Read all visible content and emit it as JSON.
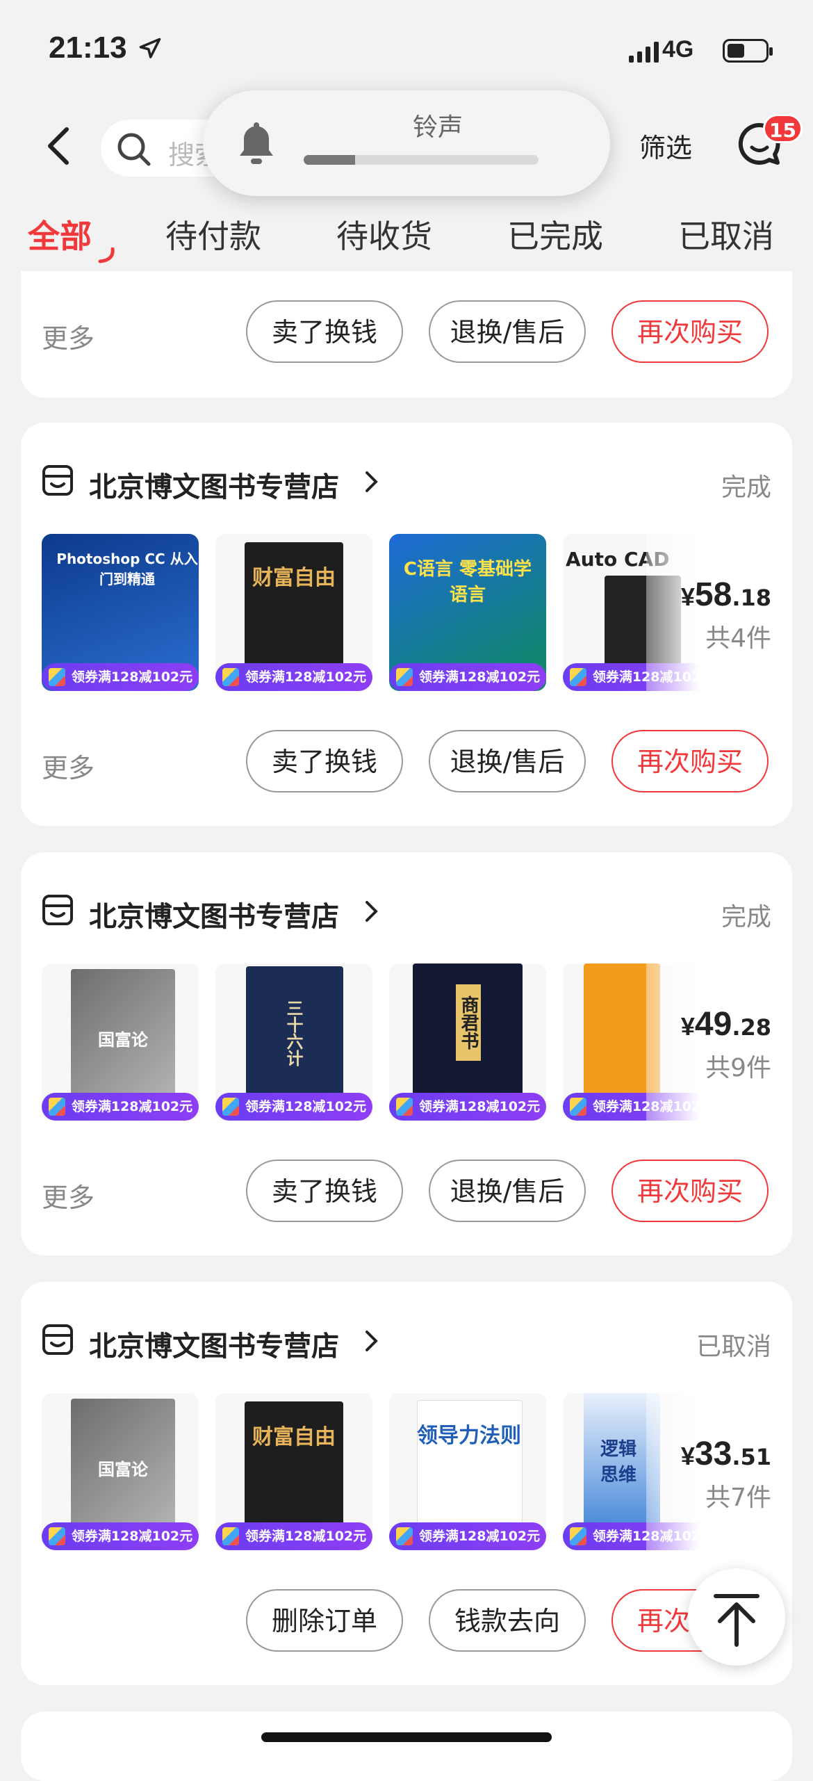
{
  "status_bar": {
    "time": "21:13",
    "network": "4G"
  },
  "header": {
    "search_placeholder": "搜索",
    "filter_label": "筛选",
    "message_badge": "15"
  },
  "hud": {
    "label": "铃声",
    "level": 0.22
  },
  "tabs": [
    {
      "label": "全部",
      "active": true
    },
    {
      "label": "待付款"
    },
    {
      "label": "待收货"
    },
    {
      "label": "已完成"
    },
    {
      "label": "已取消"
    }
  ],
  "partial_card": {
    "more_label": "更多",
    "buttons": [
      "卖了换钱",
      "退换/售后",
      "再次购买"
    ]
  },
  "orders": [
    {
      "store": "北京博文图书专营店",
      "status": "完成",
      "price_int": "58",
      "price_dec": ".18",
      "count": "共4件",
      "coupon": "领券满128减102元",
      "more_label": "更多",
      "buttons": [
        "卖了换钱",
        "退换/售后",
        "再次购买"
      ],
      "books": [
        {
          "title": "Photoshop CC 从入门到精通",
          "color": "#1c4e9b"
        },
        {
          "title": "财富自由",
          "color": "#2a2a2a"
        },
        {
          "title": "C语言 零基础学语言",
          "color": "#1e6bd6"
        },
        {
          "title": "Auto CAD",
          "color": "#d22b2b"
        }
      ]
    },
    {
      "store": "北京博文图书专营店",
      "status": "完成",
      "price_int": "49",
      "price_dec": ".28",
      "count": "共9件",
      "coupon": "领券满128减102元",
      "more_label": "更多",
      "buttons": [
        "卖了换钱",
        "退换/售后",
        "再次购买"
      ],
      "books": [
        {
          "title": "国富论",
          "color": "#8a8a8a"
        },
        {
          "title": "三十六计",
          "color": "#1b2d55"
        },
        {
          "title": "商君书",
          "color": "#141a33"
        },
        {
          "title": "",
          "color": "#f39b1d"
        }
      ]
    },
    {
      "store": "北京博文图书专营店",
      "status": "已取消",
      "price_int": "33",
      "price_dec": ".51",
      "count": "共7件",
      "coupon": "领券满128减102元",
      "buttons": [
        "删除订单",
        "钱款去向",
        "再次购买"
      ],
      "books": [
        {
          "title": "国富论",
          "color": "#8a8a8a"
        },
        {
          "title": "财富自由",
          "color": "#2a2a2a"
        },
        {
          "title": "领导力法则",
          "color": "#e7e9ee"
        },
        {
          "title": "逻辑思维",
          "color": "#2f78d4"
        }
      ]
    }
  ]
}
